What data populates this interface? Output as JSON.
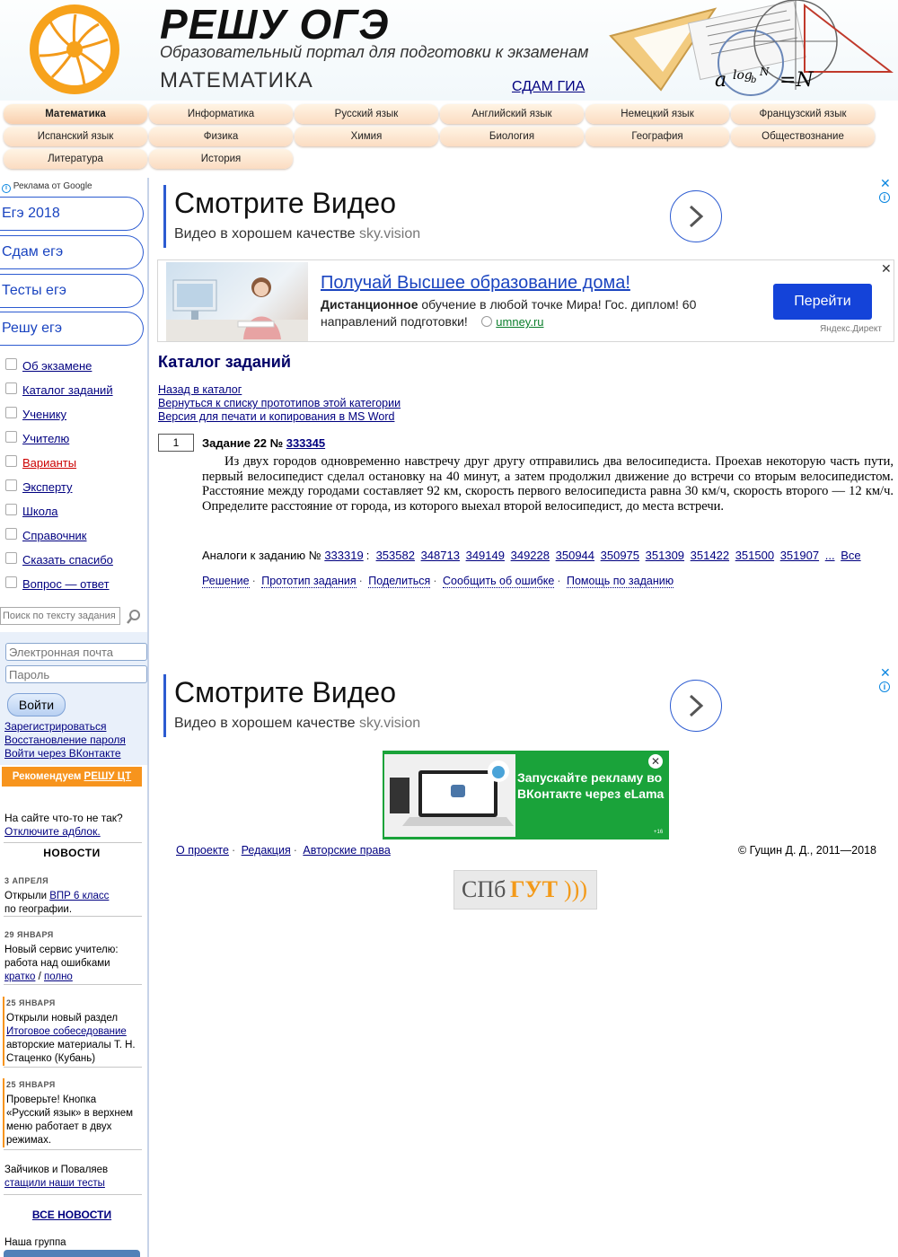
{
  "header": {
    "title": "РЕШУ ОГЭ",
    "subtitle": "Образовательный портал для подготовки к экзаменам",
    "subject": "МАТЕМАТИКА",
    "sdam_gia": "СДАМ ГИА",
    "formula_a": "a",
    "formula_log": "log",
    "formula_b": "b",
    "formula_N": "N",
    "formula_eq": "=N"
  },
  "tabs": [
    {
      "label": "Математика",
      "active": true
    },
    {
      "label": "Информатика"
    },
    {
      "label": "Русский язык"
    },
    {
      "label": "Английский язык"
    },
    {
      "label": "Немецкий язык"
    },
    {
      "label": "Французский язык"
    },
    {
      "label": "Испанский язык"
    },
    {
      "label": "Физика"
    },
    {
      "label": "Химия"
    },
    {
      "label": "Биология"
    },
    {
      "label": "География"
    },
    {
      "label": "Обществознание"
    },
    {
      "label": "Литература"
    },
    {
      "label": "История"
    }
  ],
  "sidebar": {
    "ads_by_google": "Реклама от Google",
    "ad_pills": [
      "Егэ 2018",
      "Сдам егэ",
      "Тесты егэ",
      "Решу егэ"
    ],
    "nav": [
      {
        "label": "Об экзамене"
      },
      {
        "label": "Каталог заданий"
      },
      {
        "label": "Ученику"
      },
      {
        "label": "Учителю"
      },
      {
        "label": "Варианты",
        "color": "#cc0000"
      },
      {
        "label": "Эксперту"
      },
      {
        "label": "Школа"
      },
      {
        "label": "Справочник"
      },
      {
        "label": "Сказать спасибо"
      },
      {
        "label": "Вопрос — ответ"
      }
    ],
    "search_placeholder": "Поиск по тексту задания",
    "email_placeholder": "Электронная почта",
    "password_placeholder": "Пароль",
    "login_button": "Войти",
    "register": "Зарегистрироваться",
    "restore_password": "Восстановление пароля",
    "vk_login": "Войти через ВКонтакте",
    "recommend_prefix": "Рекомендуем ",
    "recommend_link": "РЕШУ ЦТ",
    "adblock_note": "На сайте что-то не так?",
    "adblock_link": "Отключите адблок.",
    "news_title": "НОВОСТИ",
    "news": [
      {
        "date": "3 АПРЕЛЯ",
        "pre": "Открыли ",
        "link": "ВПР 6 класс",
        "post": " по географии."
      },
      {
        "date": "29 ЯНВАРЯ",
        "pre": "Новый сервис учителю: работа над ошибками",
        "link": "кратко",
        "mid": " / ",
        "link2": "полно"
      },
      {
        "date": "25 ЯНВАРЯ",
        "pre": "Открыли новый раздел",
        "link": "Итоговое собеседование",
        "post": " авторские материалы Т. Н. Стаценко (Кубань)"
      },
      {
        "date": "25 ЯНВАРЯ",
        "pre": "Проверьте! Кнопка «Русский язык» в верхнем меню работает в двух режимах."
      },
      {
        "pre": "Зайчиков и Поваляев",
        "link": "стащили наши тесты"
      }
    ],
    "all_news": "ВСЕ НОВОСТИ",
    "our_group": "Наша группа"
  },
  "ads": {
    "video_headline": "Смотрите Видео",
    "video_sub": "Видео в хорошем качестве",
    "video_domain": "sky.vision",
    "direct_title": "Получай Высшее образование дома!",
    "direct_text_bold": "Дистанционное",
    "direct_text": " обучение в любой точке Мира! Гос. диплом! 60 направлений подготовки!",
    "direct_domain": "umney.ru",
    "direct_button": "Перейти",
    "direct_credit": "Яндекс.Директ",
    "elama_text": "Запускайте рекламу во ВКонтакте через eLama",
    "elama_age": "+16"
  },
  "main": {
    "catalog_title": "Каталог заданий",
    "links": [
      "Назад в каталог",
      "Вернуться к списку прототипов этой категории",
      "Версия для печати и копирования в MS Word"
    ],
    "task_number": "1",
    "task_label": "Задание 22 № ",
    "task_id": "333345",
    "task_text": "Из двух городов одновременно навстречу друг другу отправились два велосипедиста. Проехав некоторую часть пути, первый велосипедист сделал остановку на 40 минут, а затем продолжил движение до встречи со вторым велосипедистом. Расстояние между городами составляет 92 км, скорость первого велосипедиста равна 30 км/ч, скорость второго — 12 км/ч. Определите расстояние от города, из которого выехал второй велосипедист, до места встречи.",
    "analogs_label": "Аналоги к заданию № ",
    "analogs_main": "333319",
    "analogs": [
      "353582",
      "348713",
      "349149",
      "349228",
      "350944",
      "350975",
      "351309",
      "351422",
      "351500",
      "351907"
    ],
    "analogs_more": "...",
    "analogs_all": "Все",
    "actions": [
      "Решение",
      "Прототип задания",
      "Поделиться",
      "Сообщить об ошибке",
      "Помощь по заданию"
    ]
  },
  "footer": {
    "links": [
      "О проекте",
      "Редакция",
      "Авторские права"
    ],
    "copyright": "© Гущин Д. Д., 2011—2018",
    "partner_a": "СПб",
    "partner_b": "ГУТ",
    "partner_c": ")))"
  }
}
